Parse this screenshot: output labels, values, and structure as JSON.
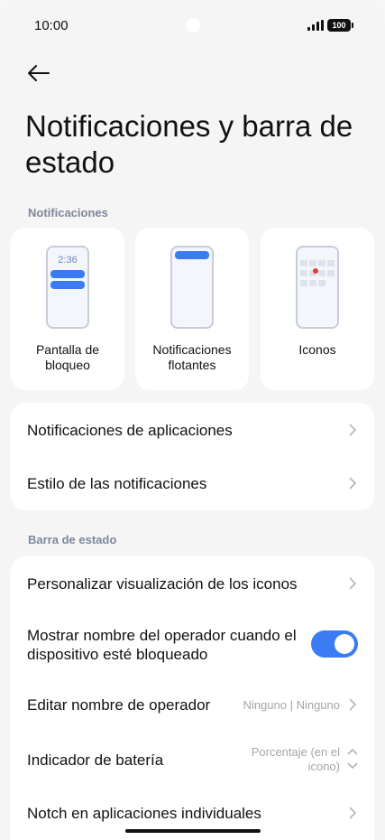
{
  "status_bar": {
    "time": "10:00",
    "battery": "100"
  },
  "page_title": "Notificaciones y barra de estado",
  "sections": {
    "notifications_label": "Notificaciones",
    "status_bar_label": "Barra de estado"
  },
  "tiles": [
    {
      "caption": "Pantalla de bloqueo",
      "clock": "2:36"
    },
    {
      "caption": "Notificaciones flotantes"
    },
    {
      "caption": "Iconos"
    }
  ],
  "notification_rows": [
    {
      "label": "Notificaciones de aplicaciones"
    },
    {
      "label": "Estilo de las notificaciones"
    }
  ],
  "status_rows": {
    "customize_icons": "Personalizar visualización de los iconos",
    "show_carrier": "Mostrar nombre del operador cuando el dispositivo esté bloqueado",
    "show_carrier_enabled": true,
    "edit_carrier": "Editar nombre de operador",
    "edit_carrier_value": "Ninguno | Ninguno",
    "battery_indicator": "Indicador de batería",
    "battery_indicator_value": "Porcentaje (en el icono)",
    "notch": "Notch en aplicaciones individuales"
  },
  "colors": {
    "accent": "#3b7cf5",
    "notification_dot": "#e53935"
  }
}
